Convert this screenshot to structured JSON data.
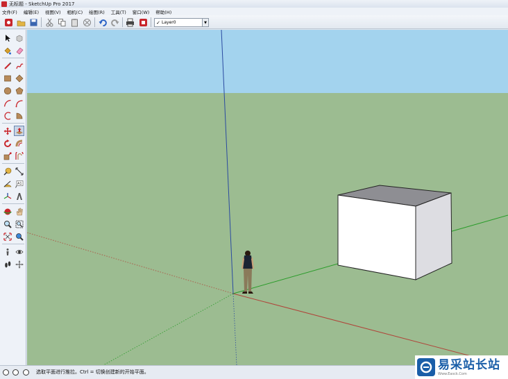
{
  "window": {
    "title": "无标题 - SketchUp Pro 2017"
  },
  "menu": {
    "items": [
      "文件(F)",
      "编辑(E)",
      "视图(V)",
      "相机(C)",
      "绘图(R)",
      "工具(T)",
      "窗口(W)",
      "帮助(H)"
    ]
  },
  "toolbar": {
    "layer": {
      "check": "✓",
      "value": "Layer0"
    }
  },
  "status": {
    "text": "选取平面进行推拉。Ctrl = 切换创建新的开始平面。"
  },
  "watermark": {
    "title": "易采站长站",
    "url": "Www.Easck.Com"
  },
  "colors": {
    "sky": "#a3d3ee",
    "ground": "#9cbc91",
    "red_axis": "#b0453a",
    "green_axis": "#2a9c2a",
    "blue_axis": "#2a4aa0",
    "box_front": "#ffffff",
    "box_side": "#dddde2",
    "box_top": "#8e8e93",
    "accent": "#1a5ea8"
  }
}
